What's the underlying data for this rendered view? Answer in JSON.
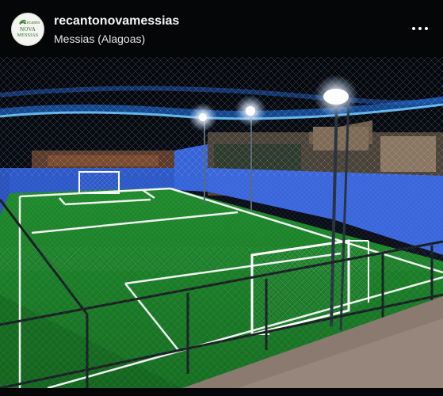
{
  "post": {
    "username": "recantonovamessias",
    "location": "Messias (Alagoas)",
    "avatar_logo_lines": [
      "Recanto",
      "NOVA",
      "MESSIAS"
    ],
    "more_icon": "more-horizontal-icon"
  },
  "photo": {
    "subject_icon": "futsal-court-photo",
    "colors": {
      "turf": "#1f8a2a",
      "turf_dark": "#12561a",
      "wall": "#2f5fd6",
      "net_glow": "#3aa8ff",
      "line": "#f2f2f2"
    }
  }
}
